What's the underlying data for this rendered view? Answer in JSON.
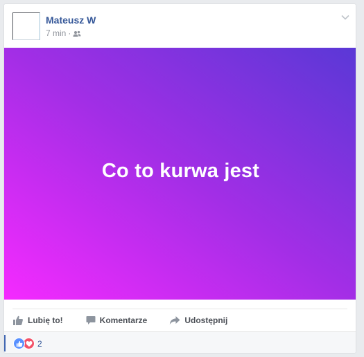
{
  "post": {
    "author": "Mateusz W",
    "timestamp": "7 min",
    "separator": "·",
    "audience_icon": "friends-icon",
    "menu_icon": "chevron-down-icon",
    "text": "Co to kurwa jest",
    "background_colors": [
      "#f52aff",
      "#a32ee6",
      "#5a38d6"
    ]
  },
  "actions": {
    "like_label": "Lubię to!",
    "comment_label": "Komentarze",
    "share_label": "Udostępnij"
  },
  "reactions": {
    "icons": [
      "like-reaction-icon",
      "love-reaction-icon"
    ],
    "count": "2"
  },
  "colors": {
    "link": "#365899",
    "accent": "#4267b2",
    "like_reaction": "#5890ff",
    "love_reaction": "#f25268"
  }
}
